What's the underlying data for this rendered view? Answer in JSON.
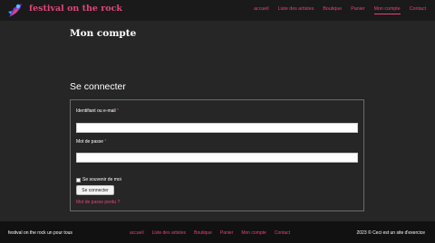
{
  "site": {
    "title": "festival on the rock",
    "logo_icon": "guitar-player-icon"
  },
  "nav": {
    "items": [
      {
        "label": "accueil"
      },
      {
        "label": "Liste des artistes"
      },
      {
        "label": "Boutique"
      },
      {
        "label": "Panier"
      },
      {
        "label": "Mon compte",
        "active": true
      },
      {
        "label": "Contact"
      }
    ]
  },
  "page": {
    "title": "Mon compte",
    "section_title": "Se connecter"
  },
  "login": {
    "username_label": "Identifiant ou e-mail",
    "password_label": "Mot de passe",
    "required_mark": "*",
    "username_value": "",
    "password_value": "",
    "remember_label": "Se souvenir de moi",
    "submit_label": "Se connecter",
    "lost_password": "Mot de passe perdu ?"
  },
  "footer": {
    "brand": "festival on the rock un pour tous",
    "nav": [
      {
        "label": "accueil"
      },
      {
        "label": "Liste des artistes"
      },
      {
        "label": "Boutique"
      },
      {
        "label": "Panier"
      },
      {
        "label": "Mon compte"
      },
      {
        "label": "Contact"
      }
    ],
    "copyright": "2023 © Ceci est un site d'exercice"
  },
  "colors": {
    "accent": "#e0457b",
    "background": "#262626",
    "header": "#1a1a1a",
    "footer": "#111111"
  }
}
